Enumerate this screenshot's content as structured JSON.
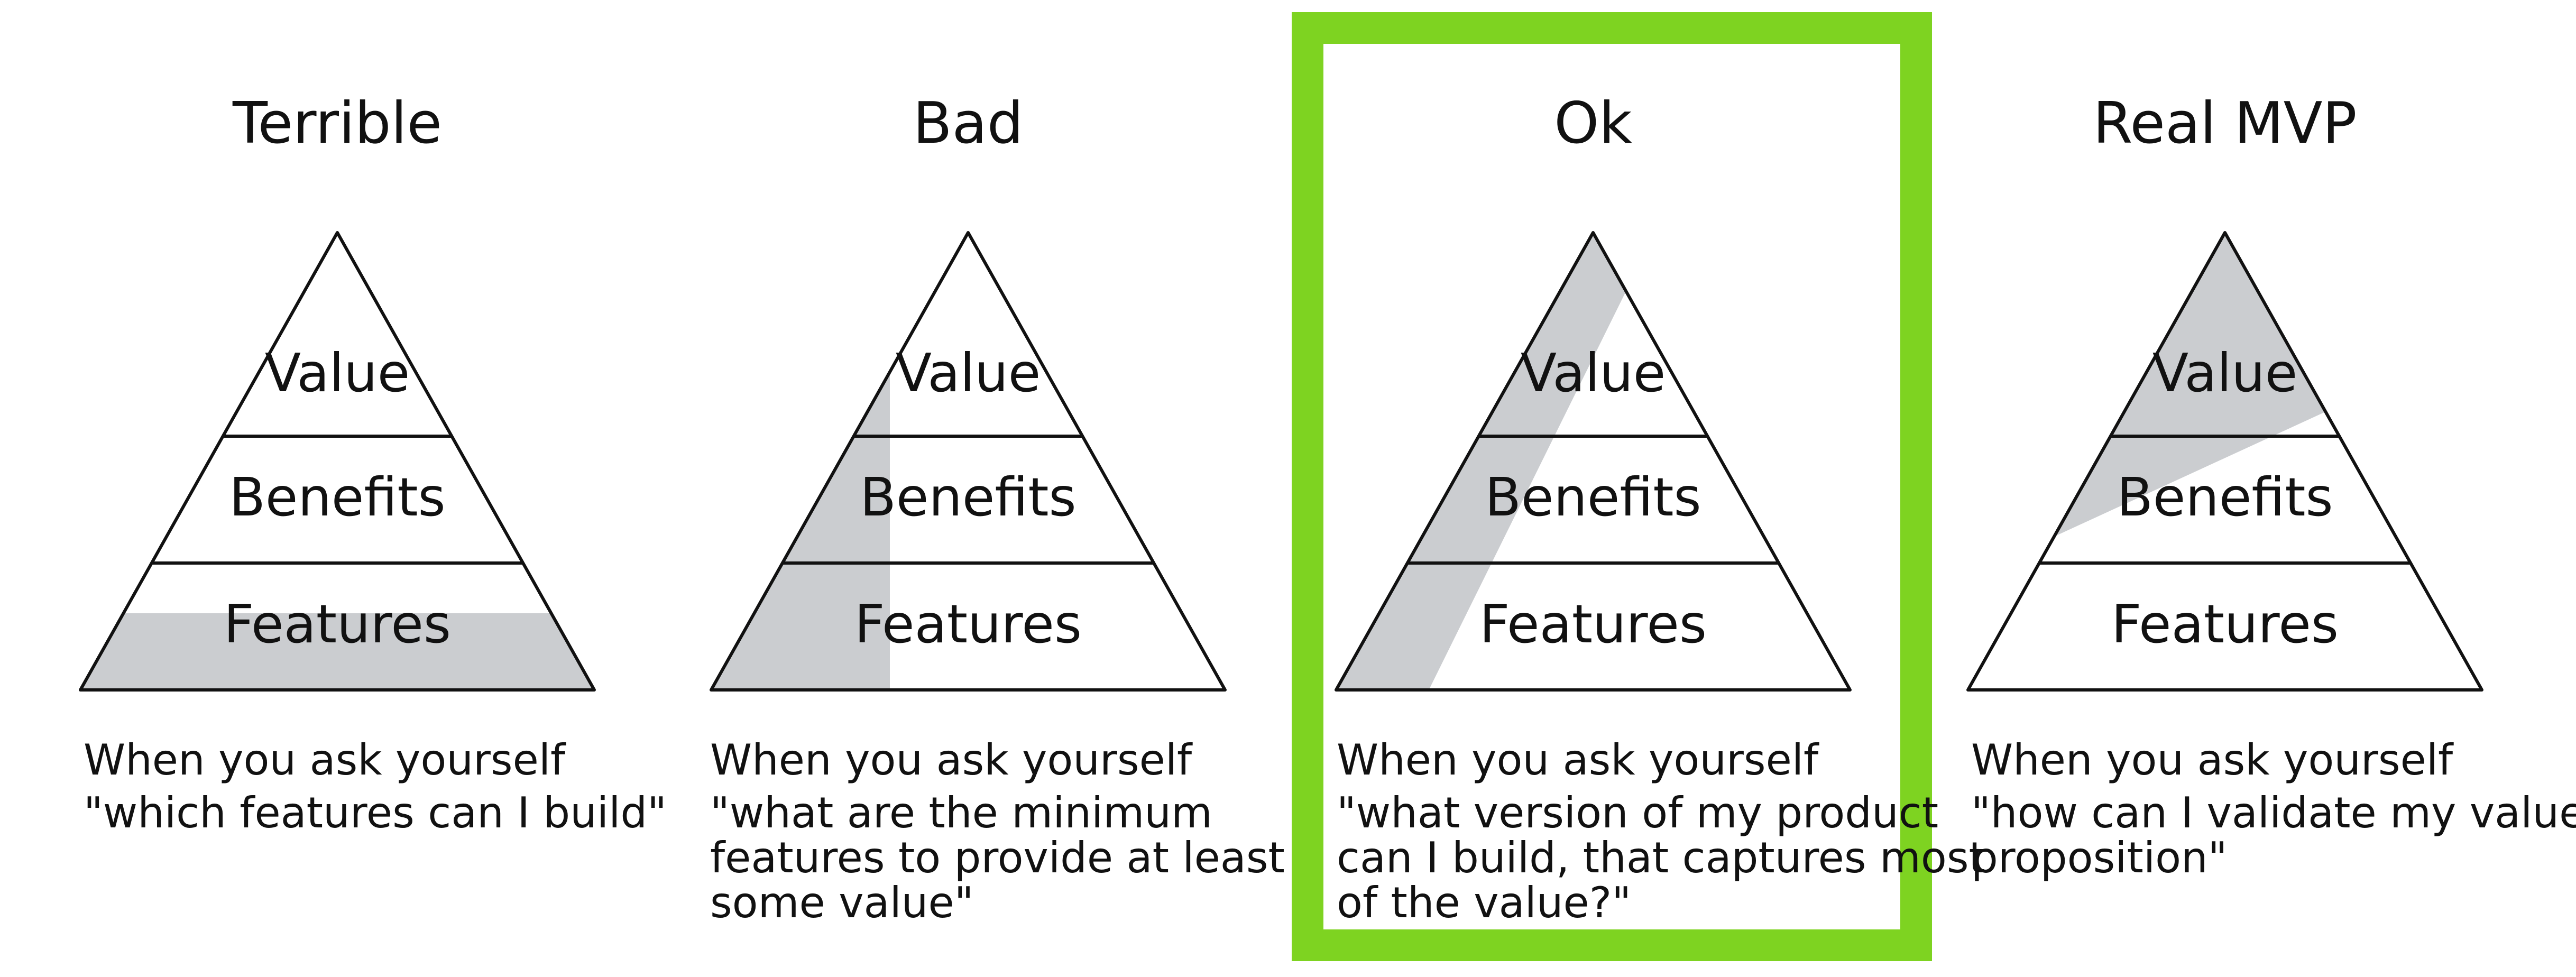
{
  "panels": [
    {
      "title": "Terrible",
      "layers": [
        "Value",
        "Benefits",
        "Features"
      ],
      "caption": [
        "When you ask yourself",
        "\"which features can I build\""
      ],
      "highlighted": false
    },
    {
      "title": "Bad",
      "layers": [
        "Value",
        "Benefits",
        "Features"
      ],
      "caption": [
        "When you ask yourself",
        "\"what are the minimum",
        "features to provide at least",
        "some value\""
      ],
      "highlighted": false
    },
    {
      "title": "Ok",
      "layers": [
        "Value",
        "Benefits",
        "Features"
      ],
      "caption": [
        "When you ask yourself",
        "\"what version of my product",
        "can I build, that captures most",
        "of the value?\""
      ],
      "highlighted": true
    },
    {
      "title": "Real MVP",
      "layers": [
        "Value",
        "Benefits",
        "Features"
      ],
      "caption": [
        "When you ask yourself",
        "\"how can I validate my value",
        "proposition\""
      ],
      "highlighted": false
    }
  ],
  "colors": {
    "highlight_frame": "#7ed321",
    "shading": "#cbcdd0",
    "ink": "#111111"
  }
}
